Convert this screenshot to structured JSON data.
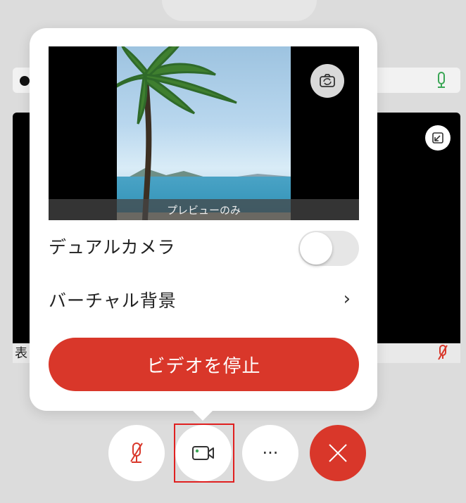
{
  "background": {
    "participant_name_partial": "表",
    "colors": {
      "mic_on": "#3aa655",
      "mic_off": "#d9372a"
    }
  },
  "video_popover": {
    "preview_label": "プレビューのみ",
    "dual_camera": {
      "label": "デュアルカメラ",
      "enabled": false
    },
    "virtual_background": {
      "label": "バーチャル背景",
      "chevron": "›"
    },
    "stop_video_label": "ビデオを停止"
  },
  "toolbar": {
    "more_label": "···",
    "icons": [
      "mic-muted-icon",
      "video-camera-icon",
      "more-icon",
      "close-icon"
    ]
  },
  "colors": {
    "accent": "#d9372a",
    "highlight": "#e02020"
  }
}
